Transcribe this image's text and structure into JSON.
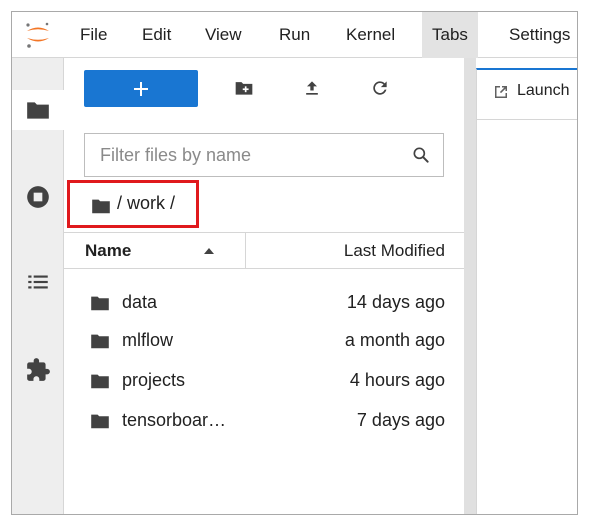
{
  "menubar": {
    "items": [
      {
        "label": "File"
      },
      {
        "label": "Edit"
      },
      {
        "label": "View"
      },
      {
        "label": "Run"
      },
      {
        "label": "Kernel"
      },
      {
        "label": "Tabs"
      },
      {
        "label": "Settings"
      }
    ],
    "active_index": 5
  },
  "activitybar": {
    "items": [
      {
        "icon": "folder-icon",
        "active": true
      },
      {
        "icon": "running-stop-icon",
        "active": false
      },
      {
        "icon": "table-of-contents-icon",
        "active": false
      },
      {
        "icon": "extension-puzzle-icon",
        "active": false
      }
    ]
  },
  "filebrowser": {
    "toolbar": {
      "new_launcher_icon": "plus-icon",
      "new_folder_icon": "new-folder-icon",
      "upload_icon": "upload-icon",
      "refresh_icon": "refresh-icon"
    },
    "filter": {
      "placeholder": "Filter files by name",
      "value": ""
    },
    "breadcrumb": "/ work /",
    "columns": {
      "name": "Name",
      "modified": "Last Modified",
      "sort": "ascending"
    },
    "files": [
      {
        "name": "data",
        "modified": "14 days ago",
        "type": "folder"
      },
      {
        "name": "mlflow",
        "modified": "a month ago",
        "type": "folder"
      },
      {
        "name": "projects",
        "modified": "4 hours ago",
        "type": "folder"
      },
      {
        "name": "tensorboar…",
        "modified": "7 days ago",
        "type": "folder"
      }
    ]
  },
  "main": {
    "tabs": [
      {
        "label": "Launch",
        "icon": "launcher-icon",
        "active": true
      }
    ]
  },
  "colors": {
    "accent": "#1976d2",
    "highlight_box": "#e0191d",
    "logo": "#f37626"
  }
}
